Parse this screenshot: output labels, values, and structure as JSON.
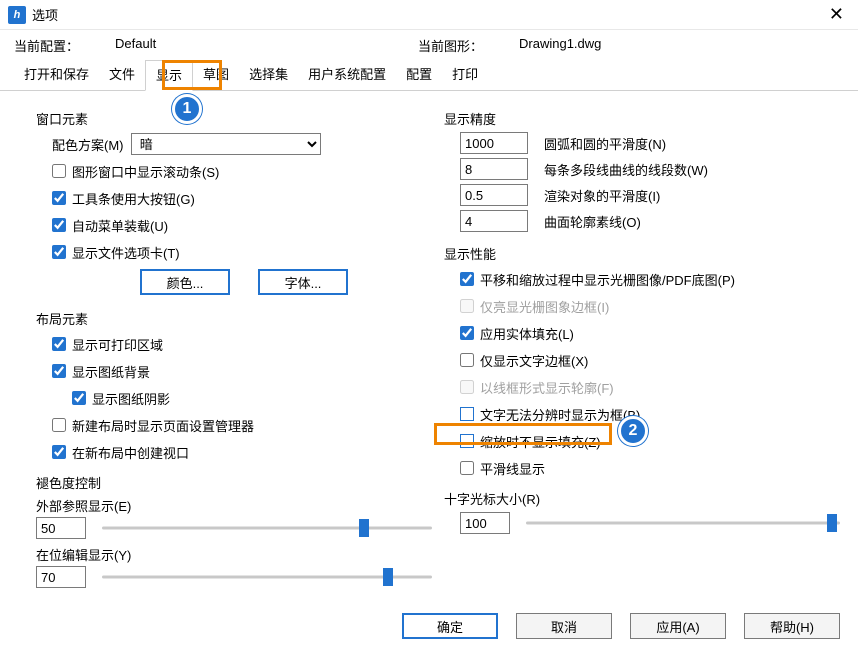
{
  "window": {
    "title": "选项",
    "close_glyph": "✕",
    "icon_letter": "h"
  },
  "info": {
    "config_label": "当前配置：",
    "config_value": "Default",
    "drawing_label": "当前图形：",
    "drawing_value": "Drawing1.dwg"
  },
  "tabs": [
    "打开和保存",
    "文件",
    "显示",
    "草图",
    "选择集",
    "用户系统配置",
    "配置",
    "打印"
  ],
  "badges": {
    "one": "1",
    "two": "2"
  },
  "left": {
    "window_elems": {
      "title": "窗口元素",
      "scheme_label": "配色方案(M)",
      "scheme_value": "暗",
      "chk_scrollbars": "图形窗口中显示滚动条(S)",
      "chk_bigbuttons": "工具条使用大按钮(G)",
      "chk_automenu": "自动菜单装载(U)",
      "chk_filetabs": "显示文件选项卡(T)",
      "btn_color": "颜色...",
      "btn_font": "字体..."
    },
    "layout_elems": {
      "title": "布局元素",
      "chk_printable": "显示可打印区域",
      "chk_paperbg": "显示图纸背景",
      "chk_papershadow": "显示图纸阴影",
      "chk_pagesetup": "新建布局时显示页面设置管理器",
      "chk_viewport": "在新布局中创建视口"
    },
    "fade": {
      "title": "褪色度控制",
      "xref_label": "外部参照显示(E)",
      "xref_value": "50",
      "inplace_label": "在位编辑显示(Y)",
      "inplace_value": "70"
    }
  },
  "right": {
    "precision": {
      "title": "显示精度",
      "arc_value": "1000",
      "arc_label": "圆弧和圆的平滑度(N)",
      "pline_value": "8",
      "pline_label": "每条多段线曲线的线段数(W)",
      "render_value": "0.5",
      "render_label": "渲染对象的平滑度(I)",
      "surf_value": "4",
      "surf_label": "曲面轮廓素线(O)"
    },
    "perf": {
      "title": "显示性能",
      "chk_panzoom": "平移和缩放过程中显示光栅图像/PDF底图(P)",
      "chk_highlight": "仅亮显光栅图象边框(I)",
      "chk_solidfill": "应用实体填充(L)",
      "chk_textframe": "仅显示文字边框(X)",
      "chk_wireframe": "以线框形式显示轮廓(F)",
      "chk_textbox": "文字无法分辨时显示为框(B)",
      "chk_nofill": "缩放时不显示填充(Z)",
      "chk_smoothline": "平滑线显示"
    },
    "cursor": {
      "title": "十字光标大小(R)",
      "value": "100"
    }
  },
  "footer": {
    "ok": "确定",
    "cancel": "取消",
    "apply": "应用(A)",
    "help": "帮助(H)"
  }
}
